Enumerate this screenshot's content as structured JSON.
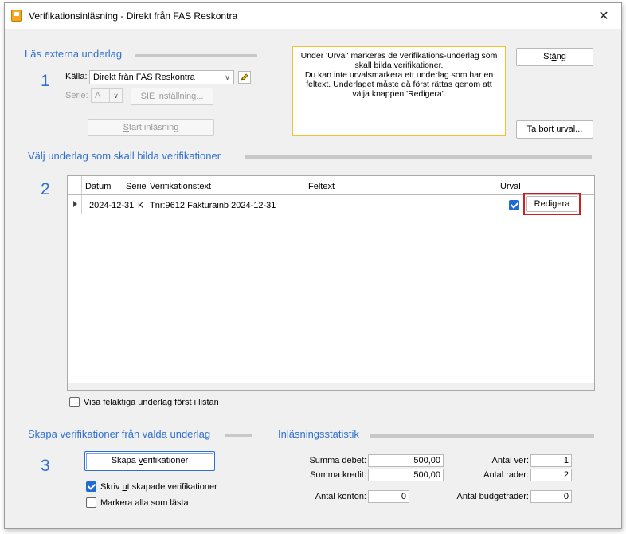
{
  "window": {
    "title": "Verifikationsinläsning - Direkt från FAS Reskontra",
    "close_glyph": "✕"
  },
  "section1": {
    "title": "Läs externa underlag",
    "number": "1",
    "kalla_label_pre": "K",
    "kalla_label_post": "älla:",
    "kalla_value": "Direkt från FAS Reskontra",
    "serie_label": "Serie:",
    "serie_value": "A",
    "sie_button": "SIE inställning...",
    "start_pre": "S",
    "start_post": "tart inläsning"
  },
  "info_text": "Under 'Urval' markeras de verifikations-underlag som skall bilda verifikationer.\nDu kan inte urvalsmarkera ett underlag som har en feltext. Underlaget måste då först rättas genom att välja knappen 'Redigera'.",
  "buttons": {
    "stang_pre": "St",
    "stang_u": "ä",
    "stang_post": "ng",
    "ta_bort": "Ta bort urval...",
    "redigera": "Redigera"
  },
  "section2": {
    "title": "Välj underlag som skall bilda verifikationer",
    "number": "2",
    "columns": {
      "datum": "Datum",
      "serie": "Serie",
      "verifikationstext": "Verifikationstext",
      "feltext": "Feltext",
      "urval": "Urval"
    },
    "rows": [
      {
        "datum": "2024-12-31",
        "serie": "K",
        "text": "Tnr:9612 Fakturainb 2024-12-31",
        "feltext": "",
        "urval": true
      }
    ],
    "visa_felaktiga": "Visa felaktiga underlag först i listan"
  },
  "section3": {
    "title": "Skapa verifikationer från valda underlag",
    "number": "3",
    "skapa_pre": "Skapa ",
    "skapa_u": "v",
    "skapa_post": "erifikationer",
    "skriv_pre": "Skriv ",
    "skriv_u": "u",
    "skriv_post": "t skapade verifikationer",
    "markera": "Markera alla som lästa"
  },
  "stats": {
    "title": "Inläsningsstatistik",
    "summa_debet_label": "Summa debet:",
    "summa_debet": "500,00",
    "summa_kredit_label": "Summa kredit:",
    "summa_kredit": "500,00",
    "antal_konton_label": "Antal konton:",
    "antal_konton": "0",
    "antal_ver_label": "Antal ver:",
    "antal_ver": "1",
    "antal_rader_label": "Antal rader:",
    "antal_rader": "2",
    "antal_budget_label": "Antal budgetrader:",
    "antal_budget": "0"
  },
  "colors": {
    "accent": "#2f6fd0",
    "info_border": "#f2c12e",
    "highlight_red": "#d01f1f"
  }
}
